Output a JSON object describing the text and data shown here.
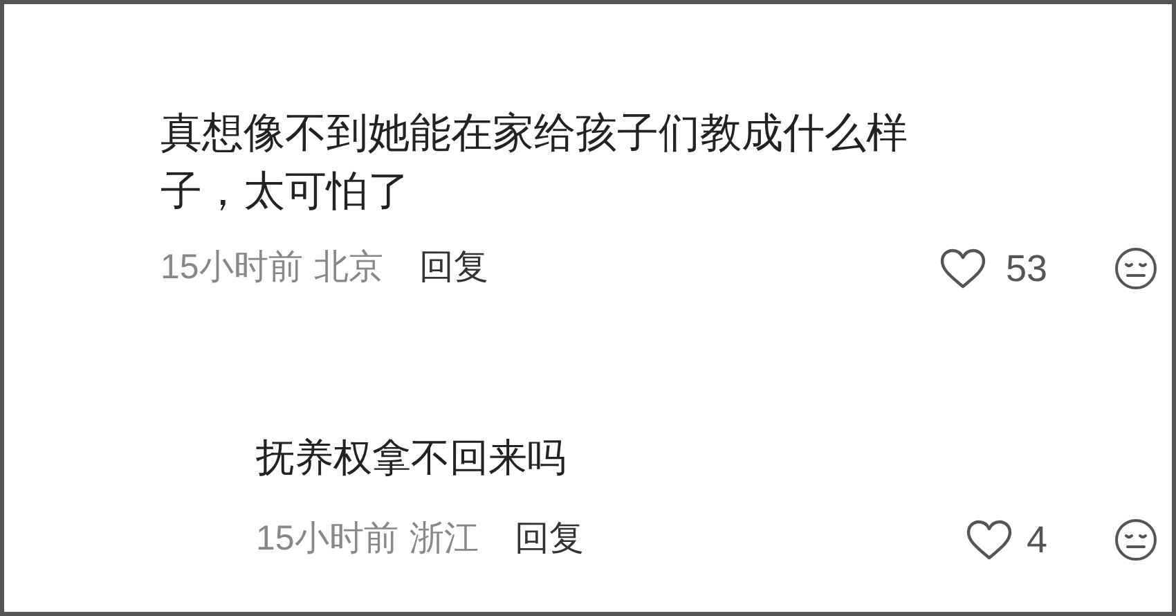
{
  "comments": [
    {
      "text": "真想像不到她能在家给孩子们教成什么样子，太可怕了",
      "time": "15小时前",
      "location": "北京",
      "reply_label": "回复",
      "likes": "53",
      "replies": [
        {
          "text": "抚养权拿不回来吗",
          "time": "15小时前",
          "location": "浙江",
          "reply_label": "回复",
          "likes": "4"
        }
      ]
    }
  ]
}
